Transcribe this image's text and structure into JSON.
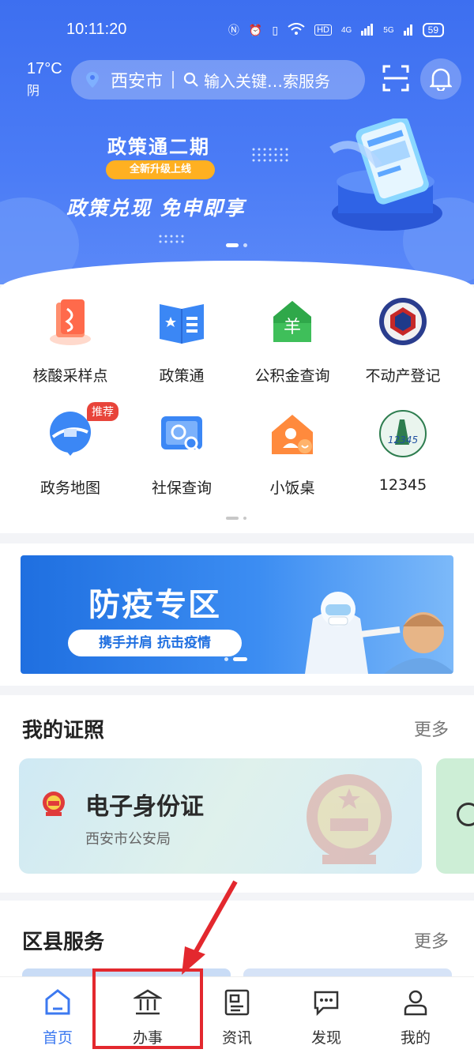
{
  "status_bar": {
    "time": "10:11:20",
    "network": "4G",
    "network2": "5G",
    "hd": "HD",
    "battery": "59"
  },
  "weather": {
    "temp": "17°C",
    "condition": "阴"
  },
  "search": {
    "city": "西安市",
    "placeholder": "输入关键…索服务"
  },
  "banner": {
    "title": "政策通二期",
    "badge": "全新升级上线",
    "slogan": "政策兑现  免申即享"
  },
  "services": [
    {
      "label": "核酸采样点",
      "icon": "nucleic-test-icon"
    },
    {
      "label": "政策通",
      "icon": "policy-book-icon"
    },
    {
      "label": "公积金查询",
      "icon": "housing-fund-icon"
    },
    {
      "label": "不动产登记",
      "icon": "real-estate-icon"
    },
    {
      "label": "政务地图",
      "icon": "gov-map-icon",
      "badge": "推荐"
    },
    {
      "label": "社保查询",
      "icon": "social-security-icon"
    },
    {
      "label": "小饭桌",
      "icon": "home-meal-icon"
    },
    {
      "label": "12345",
      "icon": "hotline-12345-icon"
    }
  ],
  "epidemic": {
    "title": "防疫专区",
    "slogan": "携手并肩  抗击疫情"
  },
  "certificates": {
    "title": "我的证照",
    "more": "更多",
    "card": {
      "name": "电子身份证",
      "issuer": "西安市公安局"
    }
  },
  "district": {
    "title": "区县服务",
    "more": "更多"
  },
  "nav": {
    "tabs": [
      {
        "label": "首页",
        "icon": "home-icon",
        "active": true
      },
      {
        "label": "办事",
        "icon": "bank-icon",
        "active": false
      },
      {
        "label": "资讯",
        "icon": "news-icon",
        "active": false
      },
      {
        "label": "发现",
        "icon": "chat-icon",
        "active": false
      },
      {
        "label": "我的",
        "icon": "user-icon",
        "active": false
      }
    ]
  },
  "colors": {
    "primary": "#3c79f0",
    "highlight": "#e3282e"
  }
}
